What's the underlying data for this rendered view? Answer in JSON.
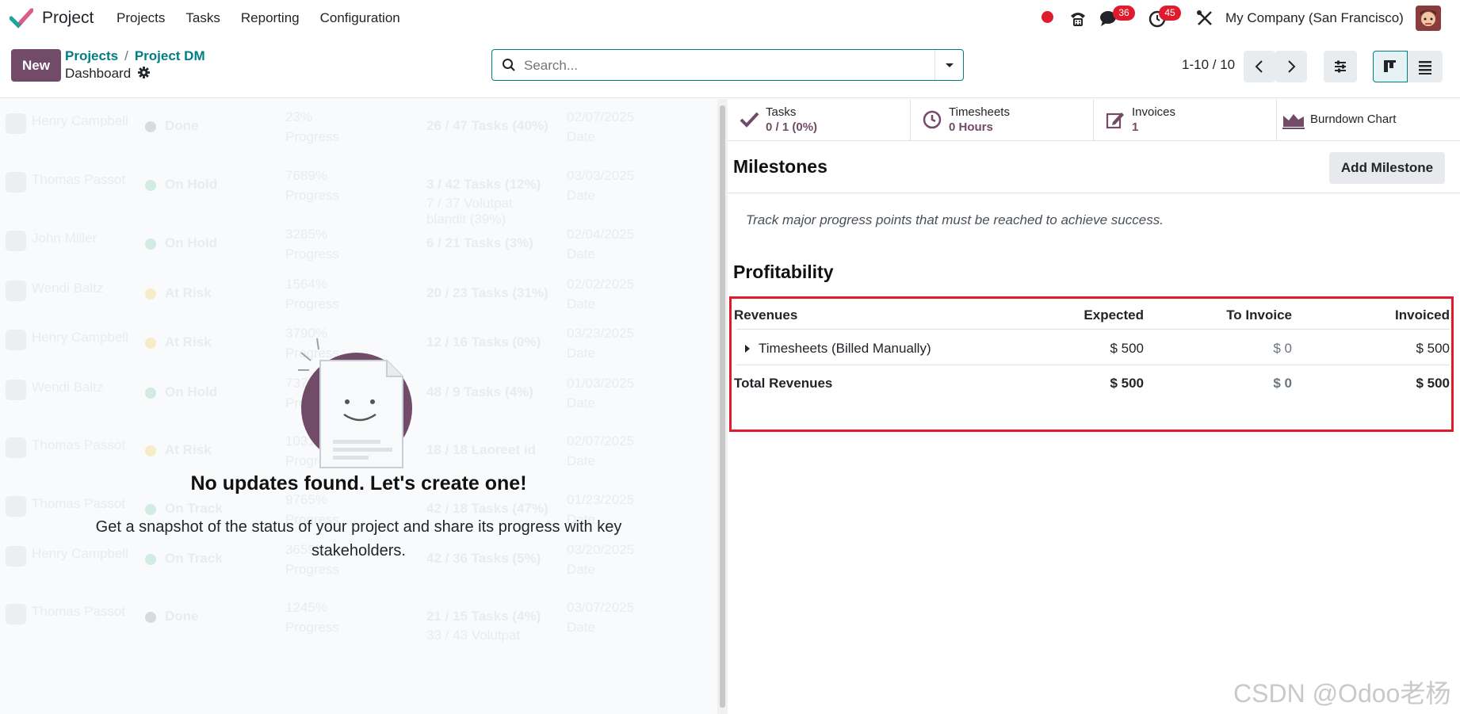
{
  "app": {
    "name": "Project",
    "menu": [
      "Projects",
      "Tasks",
      "Reporting",
      "Configuration"
    ]
  },
  "system": {
    "messages_badge": "36",
    "activities_badge": "45",
    "company": "My Company (San Francisco)"
  },
  "control": {
    "new_label": "New",
    "breadcrumb": [
      "Projects",
      "Project DM"
    ],
    "sub": "Dashboard",
    "search_placeholder": "Search...",
    "pager": "1-10 / 10"
  },
  "ghost_rows": [
    {
      "name": "Henry Campbell",
      "status": "Done",
      "progress": "23%",
      "progress_label": "Progress",
      "tasks": "26 / 47 Tasks (40%)",
      "tasks2": "",
      "date": "02/07/2025",
      "date_label": "Date",
      "dot": "#d7dbe0"
    },
    {
      "name": "Thomas Passot",
      "status": "On Hold",
      "progress": "7689%",
      "progress_label": "Progress",
      "tasks": "3 / 42 Tasks (12%)",
      "tasks2": "7 / 37 Volutpat blandit (39%)",
      "date": "03/03/2025",
      "date_label": "Date",
      "dot": "#d2ece3"
    },
    {
      "name": "John Miller",
      "status": "On Hold",
      "progress": "3285%",
      "progress_label": "Progress",
      "tasks": "6 / 21 Tasks (3%)",
      "tasks2": "",
      "date": "02/04/2025",
      "date_label": "Date",
      "dot": "#d2ece3"
    },
    {
      "name": "Wendi Baltz",
      "status": "At Risk",
      "progress": "1564%",
      "progress_label": "Progress",
      "tasks": "20 / 23 Tasks (31%)",
      "tasks2": "",
      "date": "02/02/2025",
      "date_label": "Date",
      "dot": "#f6edc8"
    },
    {
      "name": "Henry Campbell",
      "status": "At Risk",
      "progress": "3790%",
      "progress_label": "Progress",
      "tasks": "12 / 16 Tasks (0%)",
      "tasks2": "",
      "date": "03/23/2025",
      "date_label": "Date",
      "dot": "#f6edc8"
    },
    {
      "name": "Wendi Baltz",
      "status": "On Hold",
      "progress": "7370%",
      "progress_label": "Progress",
      "tasks": "48 / 9 Tasks (4%)",
      "tasks2": "",
      "date": "01/03/2025",
      "date_label": "Date",
      "dot": "#d2ece3"
    },
    {
      "name": "Thomas Passot",
      "status": "At Risk",
      "progress": "1031%",
      "progress_label": "Progress",
      "tasks": "18 / 18 Laoreet id",
      "tasks2": "",
      "date": "02/07/2025",
      "date_label": "Date",
      "dot": "#f6edc8"
    },
    {
      "name": "Thomas Passot",
      "status": "On Track",
      "progress": "9765%",
      "progress_label": "Progress",
      "tasks": "42 / 18 Tasks (47%)",
      "tasks2": "",
      "date": "01/23/2025",
      "date_label": "Date",
      "dot": "#d2ece3"
    },
    {
      "name": "Henry Campbell",
      "status": "On Track",
      "progress": "3659%",
      "progress_label": "Progress",
      "tasks": "42 / 36 Tasks (5%)",
      "tasks2": "",
      "date": "03/20/2025",
      "date_label": "Date",
      "dot": "#d2ece3"
    },
    {
      "name": "Thomas Passot",
      "status": "Done",
      "progress": "1245%",
      "progress_label": "Progress",
      "tasks": "21 / 15 Tasks (4%)",
      "tasks2": "33 / 43 Volutpat",
      "date": "03/07/2025",
      "date_label": "Date",
      "dot": "#d7dbe0"
    }
  ],
  "helper": {
    "title": "No updates found. Let's create one!",
    "text": "Get a snapshot of the status of your project and share its progress with key stakeholders."
  },
  "stats": {
    "tasks": {
      "label": "Tasks",
      "value": "0 / 1 (0%)"
    },
    "timesheets": {
      "label": "Timesheets",
      "value": "0 Hours"
    },
    "invoices": {
      "label": "Invoices",
      "value": "1"
    },
    "burndown": {
      "label": "Burndown Chart"
    }
  },
  "milestones": {
    "title": "Milestones",
    "add_label": "Add Milestone",
    "hint": "Track major progress points that must be reached to achieve success."
  },
  "profitability": {
    "title": "Profitability",
    "headers": [
      "Revenues",
      "Expected",
      "To Invoice",
      "Invoiced"
    ],
    "line": {
      "label": "Timesheets (Billed Manually)",
      "expected": "$ 500",
      "to_invoice": "$ 0",
      "invoiced": "$ 500"
    },
    "total": {
      "label": "Total Revenues",
      "expected": "$ 500",
      "to_invoice": "$ 0",
      "invoiced": "$ 500"
    }
  },
  "watermark": "CSDN @Odoo老杨",
  "colors": {
    "brand": "#714b67",
    "link": "#017e84",
    "badge": "#e01b2e",
    "highlight": "#e01b2e"
  }
}
